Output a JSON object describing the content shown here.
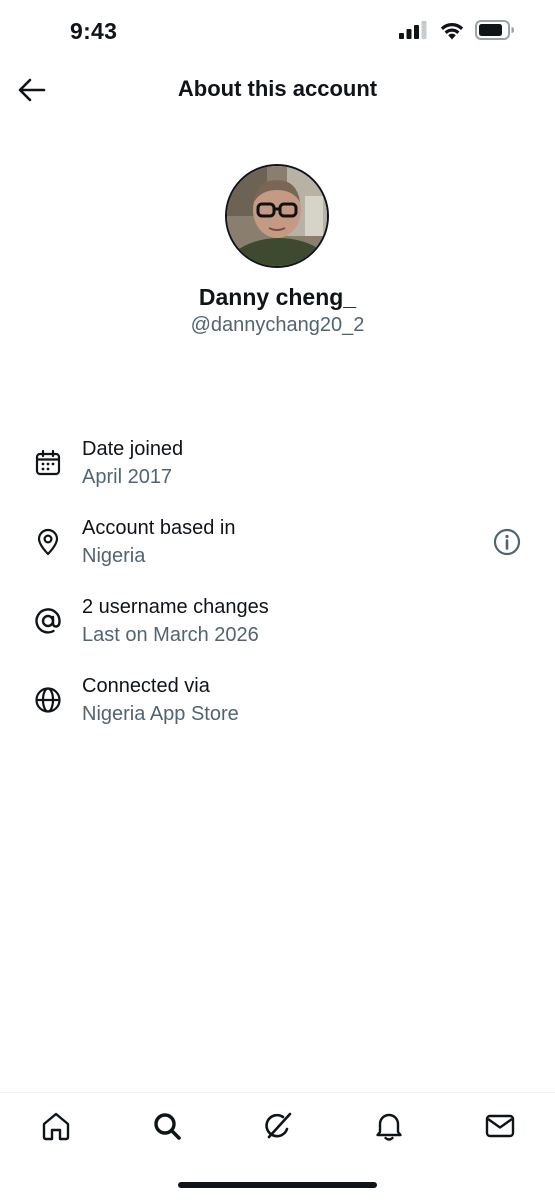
{
  "status_bar": {
    "time": "9:43"
  },
  "header": {
    "title": "About this account"
  },
  "profile": {
    "name": "Danny cheng_",
    "handle": "@dannychang20_2"
  },
  "info": [
    {
      "icon": "calendar-icon",
      "title": "Date joined",
      "value": "April 2017"
    },
    {
      "icon": "location-pin-icon",
      "title": "Account based in",
      "value": "Nigeria"
    },
    {
      "icon": "at-sign-icon",
      "title": "2 username changes",
      "value": "Last on March 2026"
    },
    {
      "icon": "globe-icon",
      "title": "Connected via",
      "value": "Nigeria App Store"
    }
  ],
  "bottom_nav": [
    "home-icon",
    "search-icon",
    "grok-icon",
    "notifications-icon",
    "messages-icon"
  ],
  "colors": {
    "text_primary": "#0f1419",
    "text_secondary": "#536471",
    "divider": "#eff3f4"
  }
}
